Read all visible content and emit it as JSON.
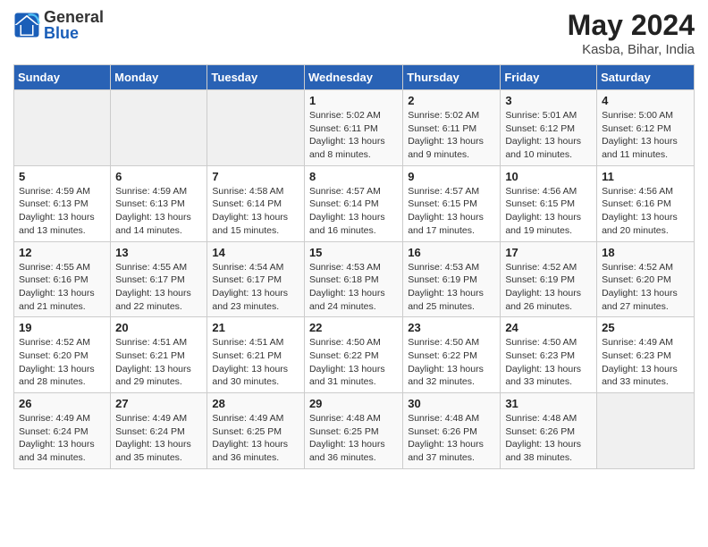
{
  "header": {
    "logo_general": "General",
    "logo_blue": "Blue",
    "month_title": "May 2024",
    "location": "Kasba, Bihar, India"
  },
  "days_of_week": [
    "Sunday",
    "Monday",
    "Tuesday",
    "Wednesday",
    "Thursday",
    "Friday",
    "Saturday"
  ],
  "weeks": [
    [
      {
        "day": "",
        "info": ""
      },
      {
        "day": "",
        "info": ""
      },
      {
        "day": "",
        "info": ""
      },
      {
        "day": "1",
        "info": "Sunrise: 5:02 AM\nSunset: 6:11 PM\nDaylight: 13 hours and 8 minutes."
      },
      {
        "day": "2",
        "info": "Sunrise: 5:02 AM\nSunset: 6:11 PM\nDaylight: 13 hours and 9 minutes."
      },
      {
        "day": "3",
        "info": "Sunrise: 5:01 AM\nSunset: 6:12 PM\nDaylight: 13 hours and 10 minutes."
      },
      {
        "day": "4",
        "info": "Sunrise: 5:00 AM\nSunset: 6:12 PM\nDaylight: 13 hours and 11 minutes."
      }
    ],
    [
      {
        "day": "5",
        "info": "Sunrise: 4:59 AM\nSunset: 6:13 PM\nDaylight: 13 hours and 13 minutes."
      },
      {
        "day": "6",
        "info": "Sunrise: 4:59 AM\nSunset: 6:13 PM\nDaylight: 13 hours and 14 minutes."
      },
      {
        "day": "7",
        "info": "Sunrise: 4:58 AM\nSunset: 6:14 PM\nDaylight: 13 hours and 15 minutes."
      },
      {
        "day": "8",
        "info": "Sunrise: 4:57 AM\nSunset: 6:14 PM\nDaylight: 13 hours and 16 minutes."
      },
      {
        "day": "9",
        "info": "Sunrise: 4:57 AM\nSunset: 6:15 PM\nDaylight: 13 hours and 17 minutes."
      },
      {
        "day": "10",
        "info": "Sunrise: 4:56 AM\nSunset: 6:15 PM\nDaylight: 13 hours and 19 minutes."
      },
      {
        "day": "11",
        "info": "Sunrise: 4:56 AM\nSunset: 6:16 PM\nDaylight: 13 hours and 20 minutes."
      }
    ],
    [
      {
        "day": "12",
        "info": "Sunrise: 4:55 AM\nSunset: 6:16 PM\nDaylight: 13 hours and 21 minutes."
      },
      {
        "day": "13",
        "info": "Sunrise: 4:55 AM\nSunset: 6:17 PM\nDaylight: 13 hours and 22 minutes."
      },
      {
        "day": "14",
        "info": "Sunrise: 4:54 AM\nSunset: 6:17 PM\nDaylight: 13 hours and 23 minutes."
      },
      {
        "day": "15",
        "info": "Sunrise: 4:53 AM\nSunset: 6:18 PM\nDaylight: 13 hours and 24 minutes."
      },
      {
        "day": "16",
        "info": "Sunrise: 4:53 AM\nSunset: 6:19 PM\nDaylight: 13 hours and 25 minutes."
      },
      {
        "day": "17",
        "info": "Sunrise: 4:52 AM\nSunset: 6:19 PM\nDaylight: 13 hours and 26 minutes."
      },
      {
        "day": "18",
        "info": "Sunrise: 4:52 AM\nSunset: 6:20 PM\nDaylight: 13 hours and 27 minutes."
      }
    ],
    [
      {
        "day": "19",
        "info": "Sunrise: 4:52 AM\nSunset: 6:20 PM\nDaylight: 13 hours and 28 minutes."
      },
      {
        "day": "20",
        "info": "Sunrise: 4:51 AM\nSunset: 6:21 PM\nDaylight: 13 hours and 29 minutes."
      },
      {
        "day": "21",
        "info": "Sunrise: 4:51 AM\nSunset: 6:21 PM\nDaylight: 13 hours and 30 minutes."
      },
      {
        "day": "22",
        "info": "Sunrise: 4:50 AM\nSunset: 6:22 PM\nDaylight: 13 hours and 31 minutes."
      },
      {
        "day": "23",
        "info": "Sunrise: 4:50 AM\nSunset: 6:22 PM\nDaylight: 13 hours and 32 minutes."
      },
      {
        "day": "24",
        "info": "Sunrise: 4:50 AM\nSunset: 6:23 PM\nDaylight: 13 hours and 33 minutes."
      },
      {
        "day": "25",
        "info": "Sunrise: 4:49 AM\nSunset: 6:23 PM\nDaylight: 13 hours and 33 minutes."
      }
    ],
    [
      {
        "day": "26",
        "info": "Sunrise: 4:49 AM\nSunset: 6:24 PM\nDaylight: 13 hours and 34 minutes."
      },
      {
        "day": "27",
        "info": "Sunrise: 4:49 AM\nSunset: 6:24 PM\nDaylight: 13 hours and 35 minutes."
      },
      {
        "day": "28",
        "info": "Sunrise: 4:49 AM\nSunset: 6:25 PM\nDaylight: 13 hours and 36 minutes."
      },
      {
        "day": "29",
        "info": "Sunrise: 4:48 AM\nSunset: 6:25 PM\nDaylight: 13 hours and 36 minutes."
      },
      {
        "day": "30",
        "info": "Sunrise: 4:48 AM\nSunset: 6:26 PM\nDaylight: 13 hours and 37 minutes."
      },
      {
        "day": "31",
        "info": "Sunrise: 4:48 AM\nSunset: 6:26 PM\nDaylight: 13 hours and 38 minutes."
      },
      {
        "day": "",
        "info": ""
      }
    ]
  ]
}
